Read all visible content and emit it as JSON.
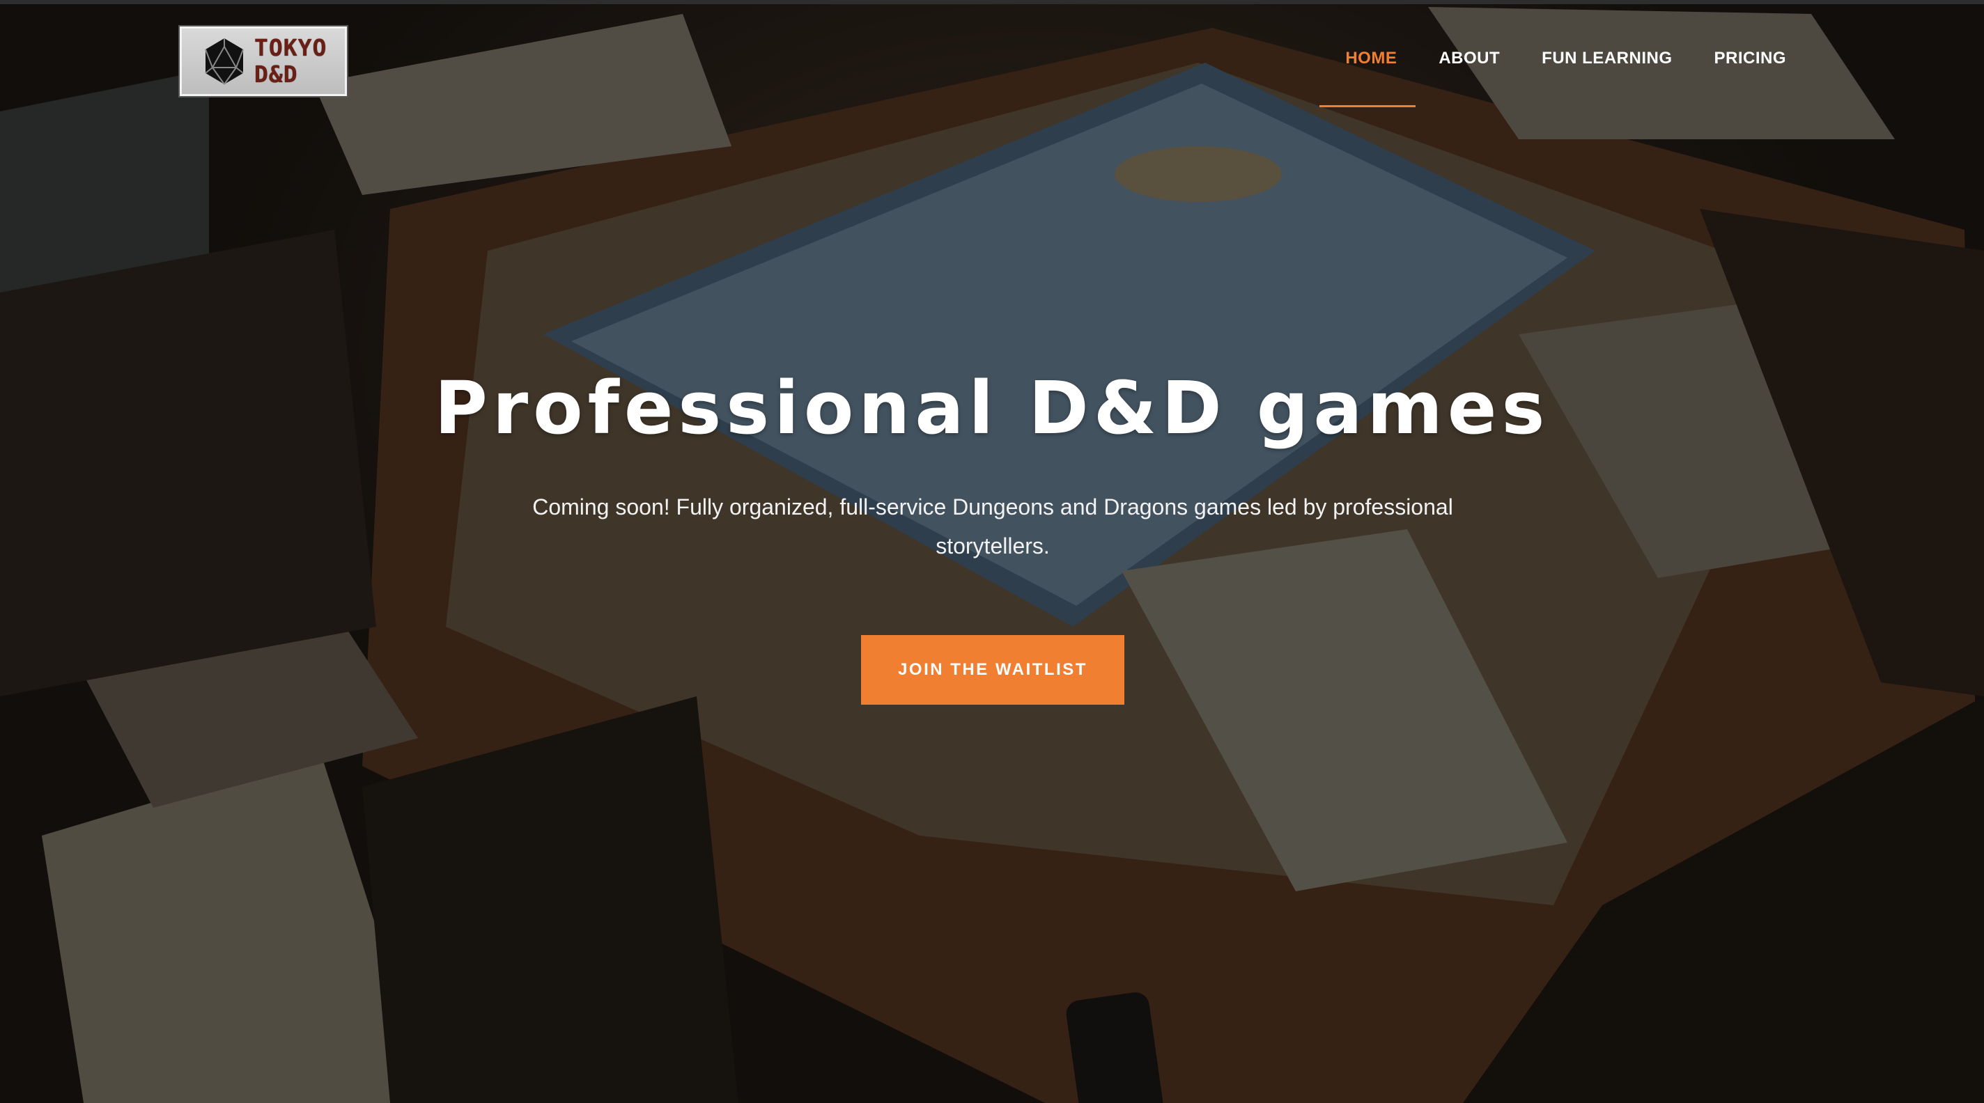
{
  "brand": {
    "logo_line1": "TOKYO",
    "logo_line2": "D&D",
    "logo_icon": "d20-icon"
  },
  "nav": {
    "items": [
      {
        "label": "HOME",
        "active": true
      },
      {
        "label": "ABOUT",
        "active": false
      },
      {
        "label": "FUN LEARNING",
        "active": false
      },
      {
        "label": "PRICING",
        "active": false
      }
    ]
  },
  "hero": {
    "title": "Professional D&D games",
    "subtitle": "Coming soon! Fully organized, full-service Dungeons and Dragons games led by professional storytellers.",
    "cta_label": "JOIN THE WAITLIST"
  },
  "colors": {
    "accent": "#f07f32",
    "text": "#ffffff",
    "overlay": "#0a0806"
  }
}
